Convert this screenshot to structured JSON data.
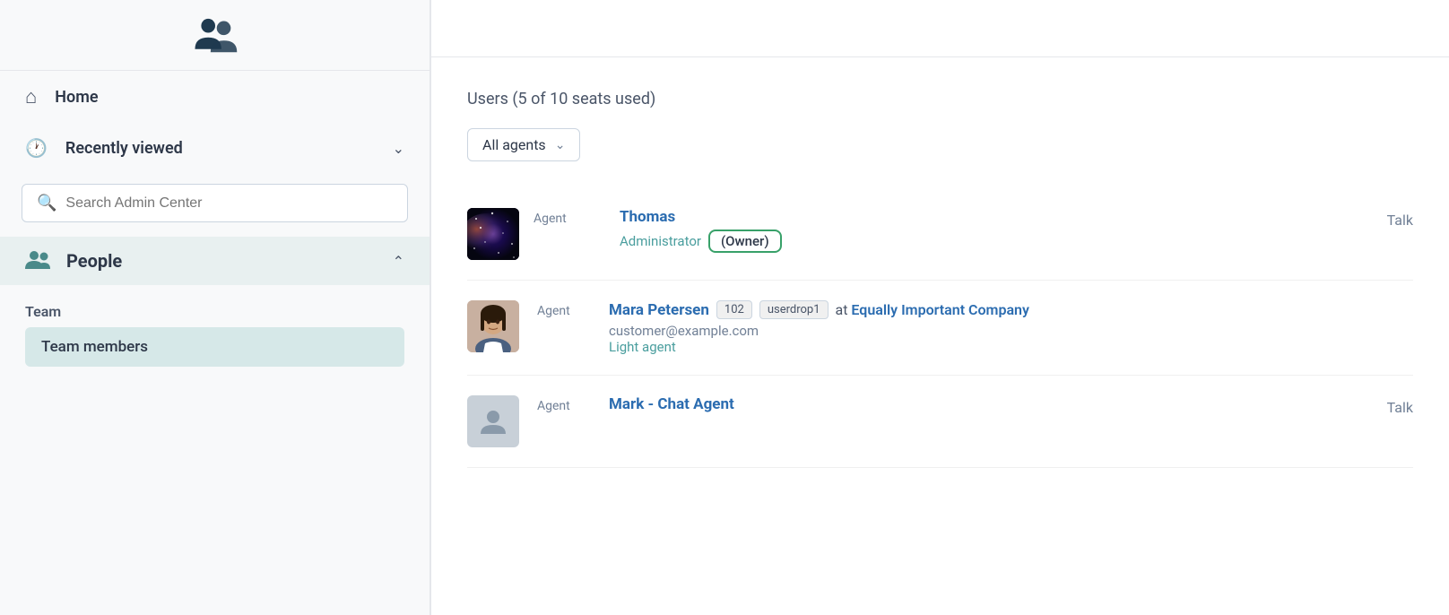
{
  "sidebar": {
    "logo_alt": "Zendesk logo",
    "nav": {
      "home": {
        "label": "Home",
        "icon": "🏠"
      },
      "recently_viewed": {
        "label": "Recently viewed",
        "icon": "🕐"
      }
    },
    "search": {
      "placeholder": "Search Admin Center"
    },
    "people": {
      "label": "People",
      "icon": "people"
    },
    "team": {
      "label": "Team",
      "members_label": "Team members"
    }
  },
  "main": {
    "users_title": "Users (5 of 10 seats used)",
    "filter": {
      "label": "All agents"
    },
    "users": [
      {
        "name": "Thomas",
        "agent_label": "Agent",
        "role": "Administrator",
        "owner_badge": "(Owner)",
        "products": "Talk",
        "avatar_type": "image"
      },
      {
        "name": "Mara Petersen",
        "agent_label": "Agent",
        "badge1": "102",
        "badge2": "userdrop1",
        "at_text": "at",
        "company": "Equally Important Company",
        "email": "customer@example.com",
        "role": "Light agent",
        "avatar_type": "photo"
      },
      {
        "name": "Mark - Chat Agent",
        "agent_label": "Agent",
        "products": "Talk",
        "avatar_type": "placeholder"
      }
    ]
  }
}
